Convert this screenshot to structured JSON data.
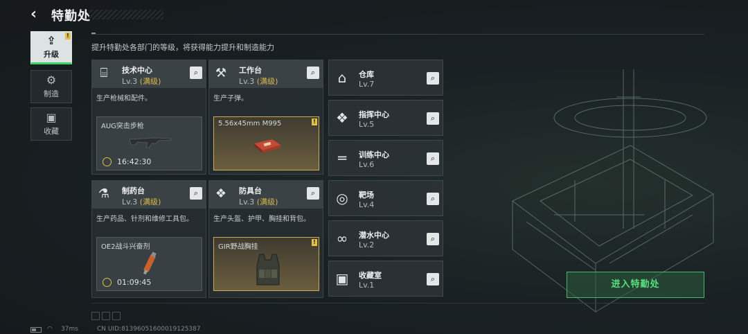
{
  "header": {
    "title": "特勤处"
  },
  "nav": [
    {
      "label": "升级",
      "icon": "upgrade-icon",
      "active": true
    },
    {
      "label": "制造",
      "icon": "gears-icon",
      "active": false
    },
    {
      "label": "收藏",
      "icon": "collection-icon",
      "active": false
    }
  ],
  "subtitle": "提升特勤处各部门的等级，将获得能力提升和制造能力",
  "cards": [
    {
      "name": "技术中心",
      "level": "Lv.3",
      "max_label": "(满级)",
      "desc": "生产枪械和配件。",
      "product": "AUG突击步枪",
      "timer": "16:42:30",
      "icon": "tech-center-icon",
      "done": false
    },
    {
      "name": "工作台",
      "level": "Lv.3",
      "max_label": "(满级)",
      "desc": "生产子弹。",
      "product": "5.56x45mm M995",
      "timer": "",
      "icon": "workbench-icon",
      "done": true
    },
    {
      "name": "制药台",
      "level": "Lv.3",
      "max_label": "(满级)",
      "desc": "生产药品、针剂和维修工具包。",
      "product": "OE2战斗兴奋剂",
      "timer": "01:09:45",
      "icon": "pharmacy-icon",
      "done": false
    },
    {
      "name": "防具台",
      "level": "Lv.3",
      "max_label": "(满级)",
      "desc": "生产头盔、护甲、胸挂和背包。",
      "product": "GIR野战胸挂",
      "timer": "",
      "icon": "armor-bench-icon",
      "done": true
    }
  ],
  "list": [
    {
      "name": "仓库",
      "level": "Lv.7",
      "icon": "warehouse-icon"
    },
    {
      "name": "指挥中心",
      "level": "Lv.5",
      "icon": "command-center-icon"
    },
    {
      "name": "训练中心",
      "level": "Lv.6",
      "icon": "training-icon"
    },
    {
      "name": "靶场",
      "level": "Lv.4",
      "icon": "shooting-range-icon"
    },
    {
      "name": "潜水中心",
      "level": "Lv.2",
      "icon": "diving-icon"
    },
    {
      "name": "收藏室",
      "level": "Lv.1",
      "icon": "collection-room-icon"
    }
  ],
  "enter_button": "进入特勤处",
  "status": {
    "ping": "37ms",
    "uid": "CN UID:813960516000191253​87"
  },
  "colors": {
    "accent_green": "#47b96a",
    "max_level": "#d9b84a",
    "badge": "#e0c04a"
  }
}
